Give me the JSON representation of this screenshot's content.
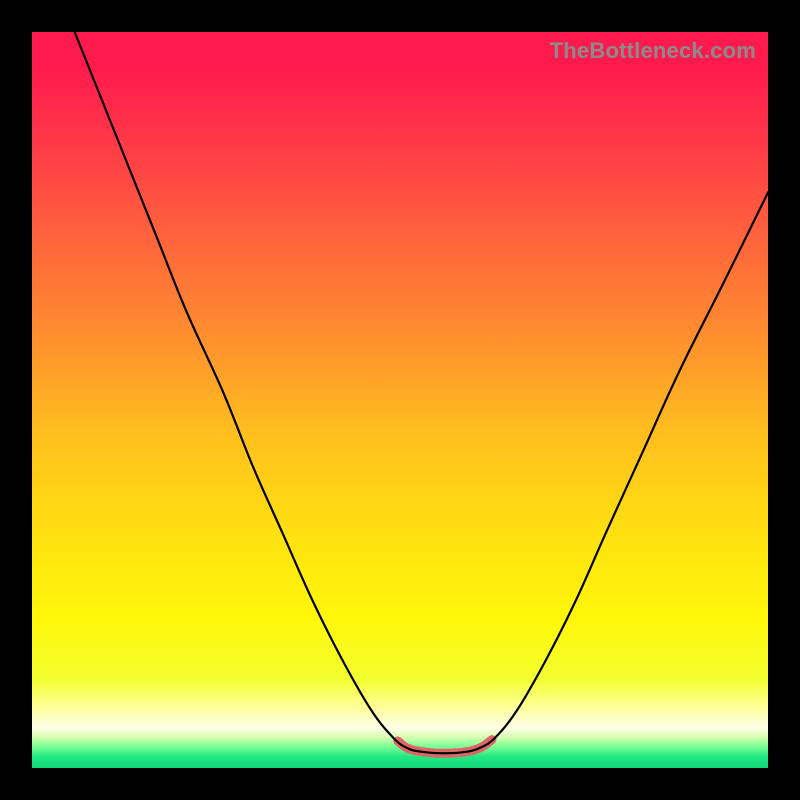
{
  "watermark": {
    "text": "TheBottleneck.com"
  },
  "gradient": {
    "stops": [
      {
        "offset": 0.0,
        "color": "#ff1a4d"
      },
      {
        "offset": 0.04,
        "color": "#ff1a4d"
      },
      {
        "offset": 0.12,
        "color": "#ff2f4a"
      },
      {
        "offset": 0.25,
        "color": "#ff5a3f"
      },
      {
        "offset": 0.4,
        "color": "#ff8a30"
      },
      {
        "offset": 0.55,
        "color": "#ffc01e"
      },
      {
        "offset": 0.68,
        "color": "#ffe010"
      },
      {
        "offset": 0.8,
        "color": "#fff80a"
      },
      {
        "offset": 0.88,
        "color": "#f2ff30"
      },
      {
        "offset": 0.92,
        "color": "#ffffa0"
      },
      {
        "offset": 0.945,
        "color": "#ffffe8"
      },
      {
        "offset": 0.958,
        "color": "#d8ffb0"
      },
      {
        "offset": 0.97,
        "color": "#80ff95"
      },
      {
        "offset": 0.985,
        "color": "#1fe884"
      },
      {
        "offset": 1.0,
        "color": "#0fd878"
      }
    ]
  },
  "curve": {
    "color_main": "#000000",
    "width_main": 2.2,
    "color_highlight": "#e06666",
    "width_highlight": 9,
    "points": [
      {
        "x": 0.058,
        "y": 0.0
      },
      {
        "x": 0.09,
        "y": 0.08
      },
      {
        "x": 0.13,
        "y": 0.18
      },
      {
        "x": 0.17,
        "y": 0.28
      },
      {
        "x": 0.21,
        "y": 0.38
      },
      {
        "x": 0.26,
        "y": 0.49
      },
      {
        "x": 0.3,
        "y": 0.59
      },
      {
        "x": 0.34,
        "y": 0.68
      },
      {
        "x": 0.38,
        "y": 0.77
      },
      {
        "x": 0.42,
        "y": 0.85
      },
      {
        "x": 0.46,
        "y": 0.92
      },
      {
        "x": 0.49,
        "y": 0.958
      },
      {
        "x": 0.51,
        "y": 0.973
      },
      {
        "x": 0.53,
        "y": 0.978
      },
      {
        "x": 0.56,
        "y": 0.98
      },
      {
        "x": 0.59,
        "y": 0.978
      },
      {
        "x": 0.61,
        "y": 0.972
      },
      {
        "x": 0.63,
        "y": 0.958
      },
      {
        "x": 0.66,
        "y": 0.92
      },
      {
        "x": 0.7,
        "y": 0.85
      },
      {
        "x": 0.74,
        "y": 0.77
      },
      {
        "x": 0.78,
        "y": 0.68
      },
      {
        "x": 0.83,
        "y": 0.57
      },
      {
        "x": 0.88,
        "y": 0.46
      },
      {
        "x": 0.94,
        "y": 0.34
      },
      {
        "x": 1.0,
        "y": 0.218
      }
    ],
    "highlight_range": {
      "start": 0.497,
      "end": 0.625
    }
  },
  "chart_data": {
    "type": "line",
    "title": "",
    "xlabel": "",
    "ylabel": "",
    "xlim": [
      0,
      1
    ],
    "ylim": [
      0,
      1
    ],
    "note": "Normalized coords. y=0 top of panel, y=1 bottom (green). Curve is a V-shaped bottleneck trough with highlighted optimal band.",
    "series": [
      {
        "name": "bottleneck-curve",
        "x": [
          0.058,
          0.09,
          0.13,
          0.17,
          0.21,
          0.26,
          0.3,
          0.34,
          0.38,
          0.42,
          0.46,
          0.49,
          0.51,
          0.53,
          0.56,
          0.59,
          0.61,
          0.63,
          0.66,
          0.7,
          0.74,
          0.78,
          0.83,
          0.88,
          0.94,
          1.0
        ],
        "y": [
          0.0,
          0.08,
          0.18,
          0.28,
          0.38,
          0.49,
          0.59,
          0.68,
          0.77,
          0.85,
          0.92,
          0.958,
          0.973,
          0.978,
          0.98,
          0.978,
          0.972,
          0.958,
          0.92,
          0.85,
          0.77,
          0.68,
          0.57,
          0.46,
          0.34,
          0.218
        ]
      }
    ],
    "highlight": {
      "series": "bottleneck-curve",
      "x_range": [
        0.497,
        0.625
      ],
      "color": "#e06666"
    },
    "background_gradient_vertical": [
      {
        "y": 0.0,
        "color": "#ff1a4d"
      },
      {
        "y": 0.55,
        "color": "#ffc01e"
      },
      {
        "y": 0.8,
        "color": "#fff80a"
      },
      {
        "y": 0.95,
        "color": "#ffffe8"
      },
      {
        "y": 1.0,
        "color": "#0fd878"
      }
    ]
  }
}
